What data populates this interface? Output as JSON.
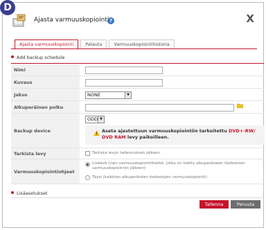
{
  "badge": "D",
  "dialog": {
    "title": "Ajasta varmuuskopiointi",
    "help_icon": "?",
    "close_label": "X"
  },
  "tabs": [
    {
      "label": "Ajasta varmuuskopiointi",
      "active": true
    },
    {
      "label": "Palauta",
      "active": false
    },
    {
      "label": "Varmuuskopiointihistoria",
      "active": false
    }
  ],
  "section_title": "Add backup schedule",
  "form": {
    "name_label": "Nimi",
    "description_label": "Kuvaus",
    "period_label": "Jakso",
    "period_value": "NONE",
    "source_path_label": "Alkuperäinen polku",
    "backup_device_label": "Backup device",
    "backup_device_value": "ODD",
    "warning_prefix": "Aseta ajastettuun varmuuskopiointiin tarkoitettu ",
    "warning_highlight": "DVD+-RW/ DVD RAM",
    "warning_suffix": " levy paikoilleen.",
    "check_disk_label": "Tarkista levy",
    "check_disk_option": "Tarkista levyn tallennuksen jälkeen",
    "guidance_label": "Varmuuskopiointiohjeet",
    "option_incremental_line1": "Lisäävä (vain varmuuskopiointitiedot, jotka on lisätty alkuperäiseen tiedostoon",
    "option_incremental_line2": "varmuuskopioinnin jälkeen)",
    "option_full": "Täysi (kaikkien alkuperäisten tiedostojen varmuuskopiointi)"
  },
  "footer_section": "Lisäasetukset",
  "buttons": {
    "save": "Tallenna",
    "cancel": "Peruuta"
  },
  "colors": {
    "accent": "#c4152d",
    "badge": "#3b3e8f",
    "cancel": "#6d6d6d"
  }
}
